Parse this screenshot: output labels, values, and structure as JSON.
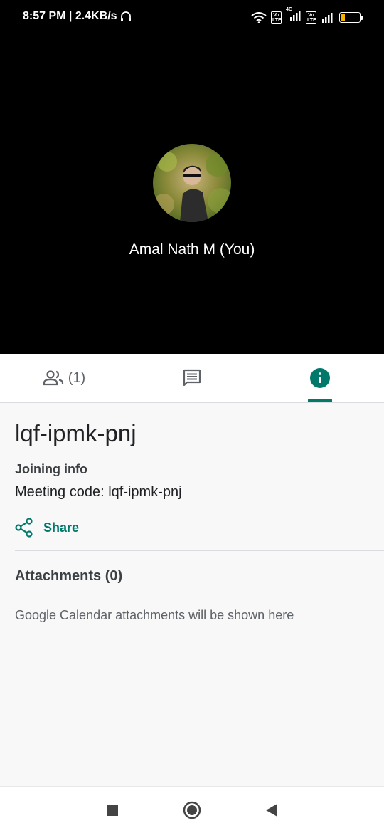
{
  "status_bar": {
    "time_speed": "8:57 PM | 2.4KB/s",
    "volte_label": "Vo LTE",
    "network_type": "4G",
    "battery_level": "23",
    "battery_fraction": 0.23
  },
  "video": {
    "participant_name": "Amal Nath M (You)"
  },
  "tabs": {
    "people_count": "(1)",
    "active_tab": "info",
    "accent_color": "#00796b"
  },
  "info": {
    "meeting_title": "lqf-ipmk-pnj",
    "joining_label": "Joining info",
    "meeting_code": "Meeting code: lqf-ipmk-pnj",
    "share_label": "Share",
    "attachments_title": "Attachments (0)",
    "attachments_hint": "Google Calendar attachments will be shown here"
  },
  "nav": {
    "icons": [
      "square-recents-icon",
      "circle-home-icon",
      "triangle-back-icon"
    ]
  }
}
